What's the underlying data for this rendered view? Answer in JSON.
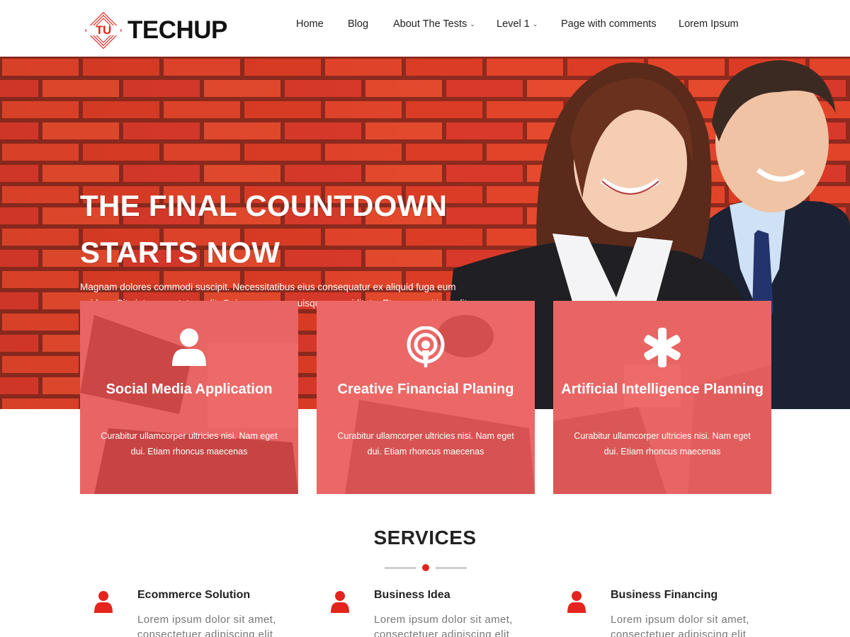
{
  "brand": {
    "logo_mark": "TU",
    "name": "TECHUP",
    "accent_color": "#e3251d"
  },
  "nav": {
    "items": [
      {
        "label": "Home",
        "has_dropdown": false
      },
      {
        "label": "Blog",
        "has_dropdown": false
      },
      {
        "label": "About The Tests",
        "has_dropdown": true
      },
      {
        "label": "Level 1",
        "has_dropdown": true
      },
      {
        "label": "Page with comments",
        "has_dropdown": false
      },
      {
        "label": "Lorem Ipsum",
        "has_dropdown": false
      }
    ],
    "dropdown_icon": "chevron-down-icon"
  },
  "hero": {
    "title_line1": "THE FINAL COUNTDOWN",
    "title_line2": "STARTS NOW",
    "text": "Magnam dolores commodi suscipit. Necessitatibus eius consequatur ex aliquid fuga eum quidem. Sit sint consectetur velit. Quisquam quos quisquam cupiditate. Et nemo qui impedit suscipit alias ea."
  },
  "features": [
    {
      "icon": "user-icon",
      "title": "Social Media Application",
      "desc": "Curabitur ullamcorper ultricies nisi. Nam eget dui. Etiam rhoncus maecenas"
    },
    {
      "icon": "podcast-icon",
      "title": "Creative Financial Planing",
      "desc": "Curabitur ullamcorper ultricies nisi. Nam eget dui. Etiam rhoncus maecenas"
    },
    {
      "icon": "asterisk-icon",
      "title": "Artificial Intelligence Planning",
      "desc": "Curabitur ullamcorper ultricies nisi. Nam eget dui. Etiam rhoncus maecenas"
    }
  ],
  "services": {
    "title": "SERVICES",
    "items": [
      {
        "icon": "user-icon",
        "title": "Ecommerce Solution",
        "text": "Lorem ipsum dolor sit amet, consectetuer adipiscing elit"
      },
      {
        "icon": "user-icon",
        "title": "Business Idea",
        "text": "Lorem ipsum dolor sit amet, consectetuer adipiscing elit"
      },
      {
        "icon": "user-icon",
        "title": "Business Financing",
        "text": "Lorem ipsum dolor sit amet, consectetuer adipiscing elit"
      }
    ]
  }
}
